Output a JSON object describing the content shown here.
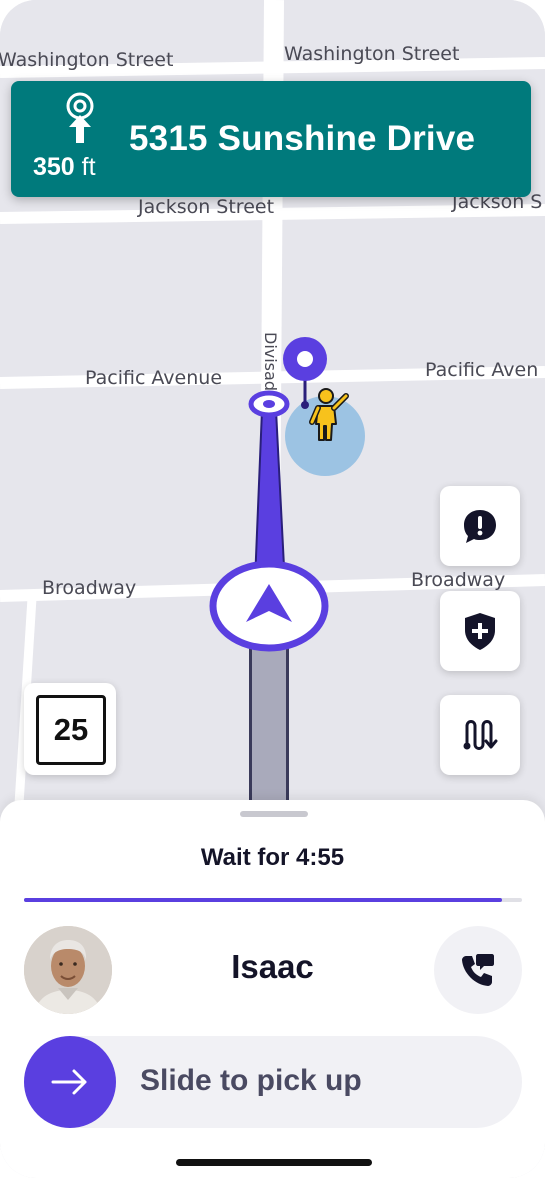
{
  "map": {
    "streets": {
      "washington_left": "Washington Street",
      "washington_right": "Washington Street",
      "jackson_left": "Jackson Street",
      "jackson_right": "Jackson S",
      "pacific_left": "Pacific Avenue",
      "pacific_right": "Pacific Aven",
      "broadway_left": "Broadway",
      "broadway_right": "Broadway",
      "divisadero": "Divisad"
    }
  },
  "navigation": {
    "distance": "350",
    "distance_unit": "ft",
    "street": "5315 Sunshine Drive"
  },
  "speed_limit": "25",
  "controls": {
    "report_icon": "alert-bubble-icon",
    "safety_icon": "shield-plus-icon",
    "route_icon": "route-options-icon"
  },
  "sheet": {
    "wait_text": "Wait for 4:55",
    "wait_progress": 0.96,
    "rider_name": "Isaac",
    "slide_label": "Slide to pick up"
  },
  "colors": {
    "brand_purple": "#5a3fe0",
    "banner_teal": "#007a7c",
    "pickup_circle": "#9cc3e3",
    "route_remaining": "#5a3fe0",
    "route_traveled": "#a9aabb"
  }
}
